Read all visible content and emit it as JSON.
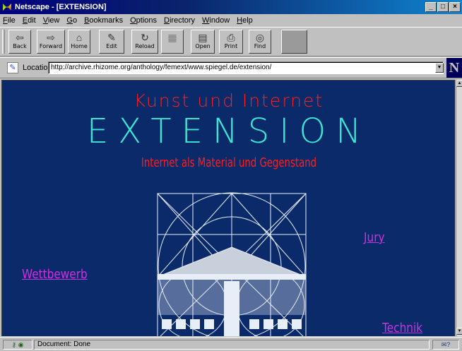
{
  "window": {
    "title": "Netscape - [EXTENSION]",
    "minimize": "_",
    "maximize": "□",
    "close": "×"
  },
  "menu": [
    "File",
    "Edit",
    "View",
    "Go",
    "Bookmarks",
    "Options",
    "Directory",
    "Window",
    "Help"
  ],
  "toolbar": {
    "back": "Back",
    "forward": "Forward",
    "home": "Home",
    "edit": "Edit",
    "reload": "Reload",
    "images": "Images",
    "open": "Open",
    "print": "Print",
    "find": "Find"
  },
  "location": {
    "label": "Location:",
    "url": "http://archive.rhizome.org/anthology/femext/www.spiegel.de/extension/"
  },
  "page": {
    "heading_small": "Kunst und Internet",
    "heading_main": "EXTENSION",
    "subheading": "Internet als Material und Gegenstand",
    "link_jury": "Jury",
    "link_wettbewerb": "Wettbewerb",
    "link_technik": "Technik"
  },
  "colors": {
    "page_background": "#0a2a6a",
    "heading_red": "#ff1f1f",
    "heading_cyan": "#3ce6d2",
    "link_magenta": "#d030e0"
  },
  "status": {
    "text": "Document: Done"
  },
  "logo": "N"
}
